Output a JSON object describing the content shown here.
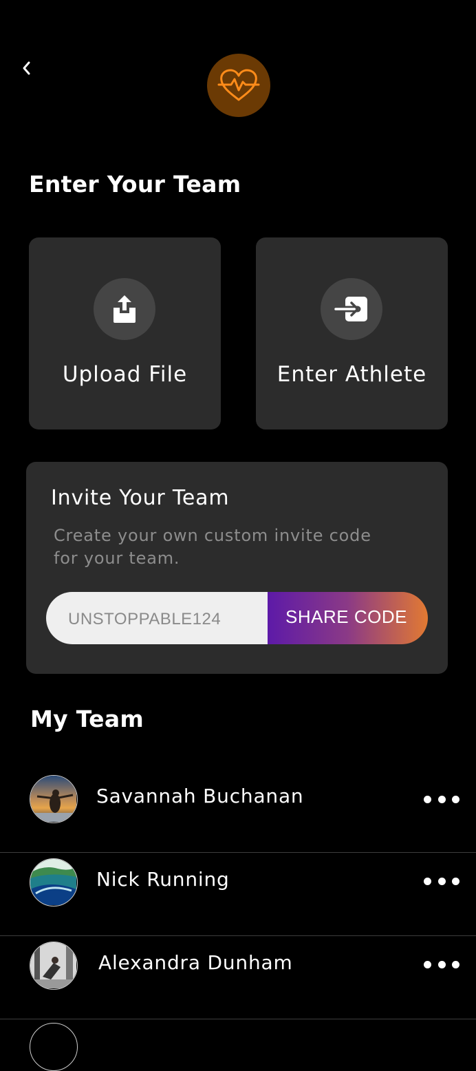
{
  "header": {
    "back_icon": "chevron-left-icon",
    "logo_icon": "heart-pulse-icon",
    "logo_color": "#ff8c1a",
    "logo_bg": "#6b3a04"
  },
  "enter_team": {
    "title": "Enter Your Team",
    "upload": {
      "label": "Upload File",
      "icon": "upload-tray-icon"
    },
    "athlete": {
      "label": "Enter Athlete",
      "icon": "enter-arrow-icon"
    }
  },
  "invite": {
    "title": "Invite Your Team",
    "description": "Create your own custom invite code for your team.",
    "code_value": "UNSTOPPABLE124",
    "share_label": "SHARE CODE",
    "gradient": [
      "#5d1aa8",
      "#e27a32"
    ]
  },
  "my_team": {
    "title": "My Team",
    "members": [
      {
        "name": "Savannah Buchanan",
        "avatar": "sunset-photo"
      },
      {
        "name": "Nick Running",
        "avatar": "wave-photo"
      },
      {
        "name": "Alexandra Dunham",
        "avatar": "gym-photo"
      }
    ]
  }
}
